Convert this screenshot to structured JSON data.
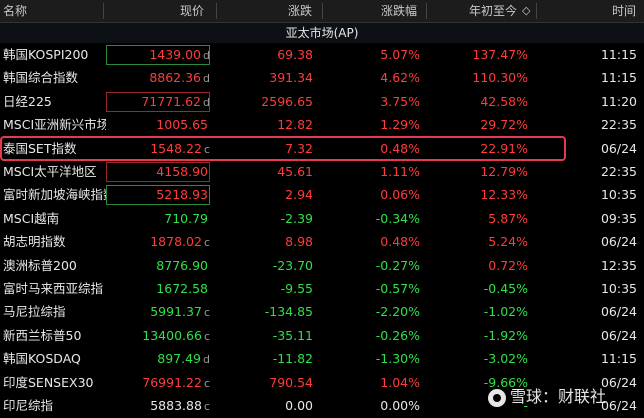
{
  "header": {
    "name": "名称",
    "price": "现价",
    "change": "涨跌",
    "change_pct": "涨跌幅",
    "ytd": "年初至今",
    "time": "时间",
    "sort_arrow": "◇"
  },
  "section_title": "亚太市场(AP)",
  "rows": [
    {
      "name": "韩国KOSPI200",
      "price": "1439.00",
      "suffix": "d",
      "change": "69.38",
      "pct": "5.07%",
      "ytd": "137.47%",
      "time": "11:15",
      "dir": "up",
      "ytd_dir": "up",
      "box": "green"
    },
    {
      "name": "韩国综合指数",
      "price": "8862.36",
      "suffix": "d",
      "change": "391.34",
      "pct": "4.62%",
      "ytd": "110.30%",
      "time": "11:15",
      "dir": "up",
      "ytd_dir": "up",
      "box": ""
    },
    {
      "name": "日经225",
      "price": "71771.62",
      "suffix": "d",
      "change": "2596.65",
      "pct": "3.75%",
      "ytd": "42.58%",
      "time": "11:20",
      "dir": "up",
      "ytd_dir": "up",
      "box": "red"
    },
    {
      "name": "MSCI亚洲新兴市场",
      "price": "1005.65",
      "suffix": "",
      "change": "12.82",
      "pct": "1.29%",
      "ytd": "29.72%",
      "time": "22:35",
      "dir": "up",
      "ytd_dir": "up",
      "box": ""
    },
    {
      "name": "泰国SET指数",
      "price": "1548.22",
      "suffix": "c",
      "change": "7.32",
      "pct": "0.48%",
      "ytd": "22.91%",
      "time": "06/24",
      "dir": "up",
      "ytd_dir": "up",
      "box": ""
    },
    {
      "name": "MSCI太平洋地区",
      "price": "4158.90",
      "suffix": "",
      "change": "45.61",
      "pct": "1.11%",
      "ytd": "12.79%",
      "time": "22:35",
      "dir": "up",
      "ytd_dir": "up",
      "box": "red"
    },
    {
      "name": "富时新加坡海峡指数",
      "price": "5218.93",
      "suffix": "",
      "change": "2.94",
      "pct": "0.06%",
      "ytd": "12.33%",
      "time": "10:35",
      "dir": "up",
      "ytd_dir": "up",
      "box": "green"
    },
    {
      "name": "MSCI越南",
      "price": "710.79",
      "suffix": "",
      "change": "-2.39",
      "pct": "-0.34%",
      "ytd": "5.87%",
      "time": "09:35",
      "dir": "down",
      "ytd_dir": "up",
      "box": ""
    },
    {
      "name": "胡志明指数",
      "price": "1878.02",
      "suffix": "c",
      "change": "8.98",
      "pct": "0.48%",
      "ytd": "5.24%",
      "time": "06/24",
      "dir": "up",
      "ytd_dir": "up",
      "box": ""
    },
    {
      "name": "澳洲标普200",
      "price": "8776.90",
      "suffix": "",
      "change": "-23.70",
      "pct": "-0.27%",
      "ytd": "0.72%",
      "time": "12:35",
      "dir": "down",
      "ytd_dir": "up",
      "box": ""
    },
    {
      "name": "富时马来西亚综指",
      "price": "1672.58",
      "suffix": "",
      "change": "-9.55",
      "pct": "-0.57%",
      "ytd": "-0.45%",
      "time": "10:35",
      "dir": "down",
      "ytd_dir": "down",
      "box": ""
    },
    {
      "name": "马尼拉综指",
      "price": "5991.37",
      "suffix": "c",
      "change": "-134.85",
      "pct": "-2.20%",
      "ytd": "-1.02%",
      "time": "06/24",
      "dir": "down",
      "ytd_dir": "down",
      "box": ""
    },
    {
      "name": "新西兰标普50",
      "price": "13400.66",
      "suffix": "c",
      "change": "-35.11",
      "pct": "-0.26%",
      "ytd": "-1.92%",
      "time": "06/24",
      "dir": "down",
      "ytd_dir": "down",
      "box": ""
    },
    {
      "name": "韩国KOSDAQ",
      "price": "897.49",
      "suffix": "d",
      "change": "-11.82",
      "pct": "-1.30%",
      "ytd": "-3.02%",
      "time": "11:15",
      "dir": "down",
      "ytd_dir": "down",
      "box": ""
    },
    {
      "name": "印度SENSEX30",
      "price": "76991.22",
      "suffix": "c",
      "change": "790.54",
      "pct": "1.04%",
      "ytd": "-9.66%",
      "time": "06/24",
      "dir": "up",
      "ytd_dir": "down",
      "box": ""
    },
    {
      "name": "印尼综指",
      "price": "5883.88",
      "suffix": "c",
      "change": "0.00",
      "pct": "0.00%",
      "ytd": "-",
      "time": "06/24",
      "dir": "flat",
      "ytd_dir": "down",
      "box": ""
    }
  ],
  "watermark": "雪球：财联社",
  "colors": {
    "up": "#ff3b3b",
    "down": "#2ee04a",
    "highlight": "#e8384f"
  }
}
